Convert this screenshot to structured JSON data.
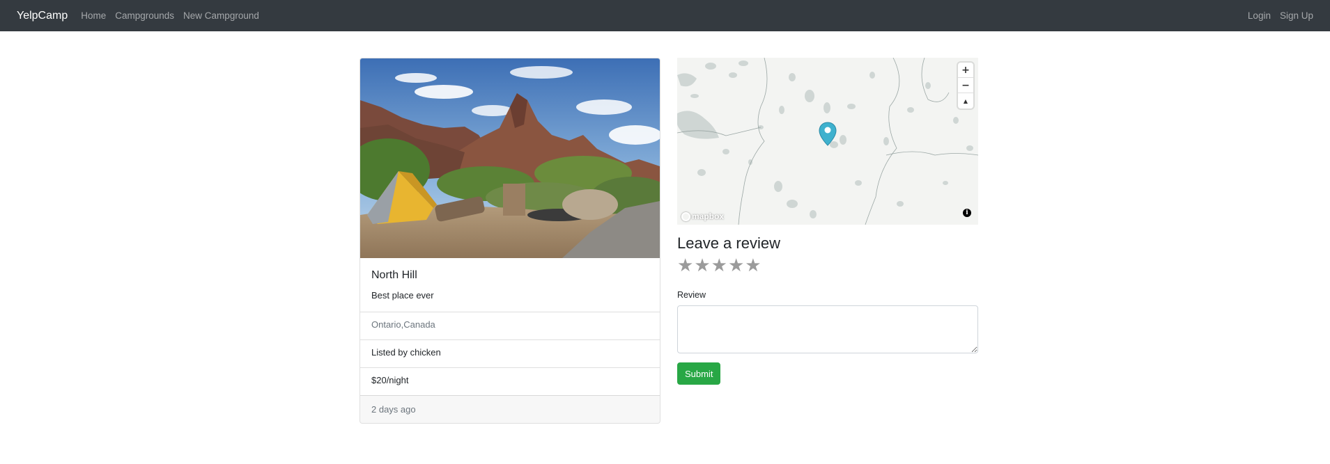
{
  "navbar": {
    "brand": "YelpCamp",
    "links": [
      "Home",
      "Campgrounds",
      "New Campground"
    ],
    "auth_links": [
      "Login",
      "Sign Up"
    ]
  },
  "campground": {
    "title": "North Hill",
    "description": "Best place ever",
    "location": "Ontario,Canada",
    "author_line": "Listed by chicken",
    "price_line": "$20/night",
    "posted": "2 days ago"
  },
  "map": {
    "zoom_in": "+",
    "zoom_out": "−",
    "compass": "▲",
    "attribution": "mapbox",
    "info": "i",
    "marker_color": "#3fb1ce"
  },
  "review_form": {
    "heading": "Leave a review",
    "stars": [
      "★",
      "★",
      "★",
      "★",
      "★"
    ],
    "review_label": "Review",
    "submit_label": "Submit"
  },
  "colors": {
    "navbar_bg": "#343a40",
    "submit_bg": "#28a745",
    "star_color": "#9b9b9b"
  }
}
